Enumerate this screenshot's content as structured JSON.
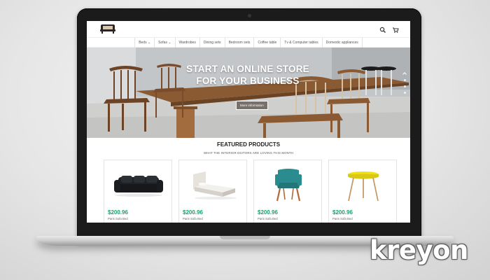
{
  "brand": "kreyon",
  "nav": {
    "items": [
      {
        "label": "Beds ⌄"
      },
      {
        "label": "Sofas ⌄"
      },
      {
        "label": "Wardrobes"
      },
      {
        "label": "Dining sets"
      },
      {
        "label": "Bedroom sets"
      },
      {
        "label": "Coffee table"
      },
      {
        "label": "Tv & Computer tables"
      },
      {
        "label": "Domestic appliances"
      }
    ]
  },
  "header": {
    "icons": [
      "search-icon",
      "cart-icon"
    ]
  },
  "hero": {
    "title_line1": "START AN ONLINE STORE",
    "title_line2": "FOR YOUR BUSINESS",
    "button_label": "More information"
  },
  "featured": {
    "title": "FEATURED PRODUCTS",
    "subtitle": "WHAT THE INTERIOR EDITORS ARE LOVING THIS MONTH",
    "products": [
      {
        "price": "$200.96",
        "name": "Paris Sofa Bed",
        "icon": "black-sofa"
      },
      {
        "price": "$200.96",
        "name": "Paris Sofa Bed",
        "icon": "white-bed"
      },
      {
        "price": "$200.96",
        "name": "Paris Sofa Bed",
        "icon": "teal-armchair"
      },
      {
        "price": "$200.96",
        "name": "Paris Sofa Bed",
        "icon": "yellow-side-table"
      }
    ]
  },
  "colors": {
    "price": "#1aa06b",
    "accent_chair": "#2a8c8e",
    "table_yellow": "#f0e01a"
  }
}
